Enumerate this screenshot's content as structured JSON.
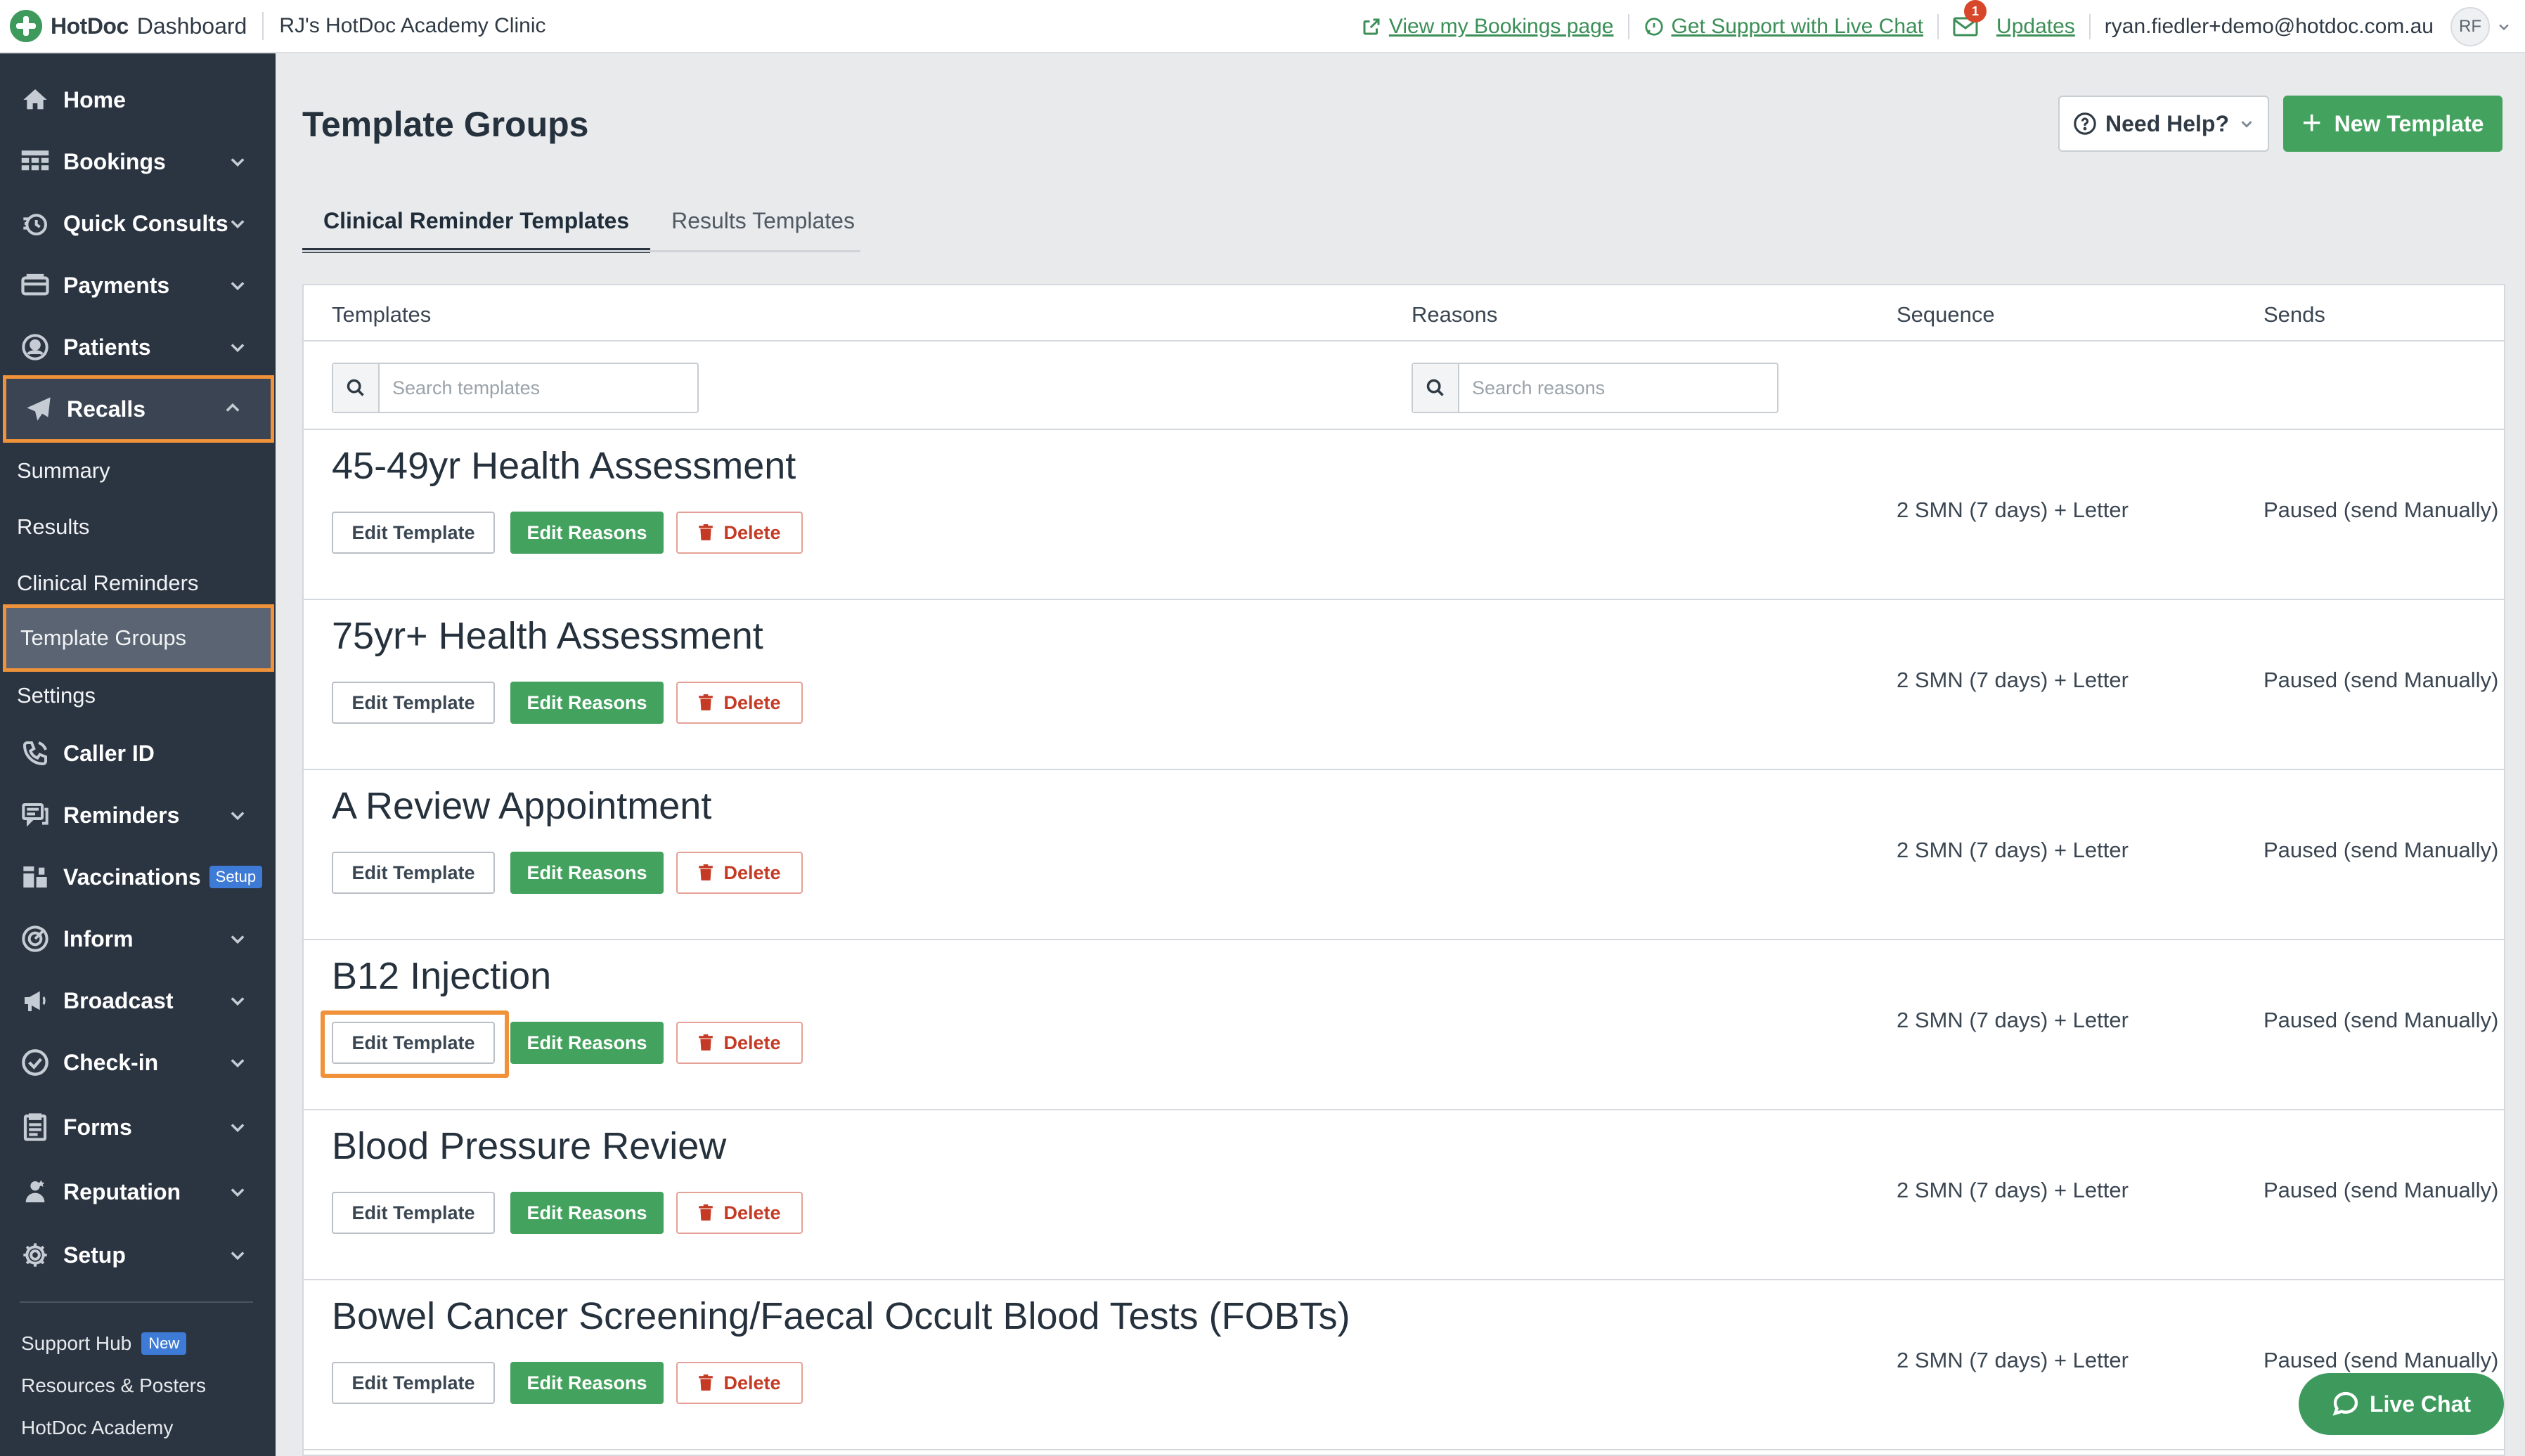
{
  "topbar": {
    "brand_name": "HotDoc",
    "brand_sub": "Dashboard",
    "clinic": "RJ's HotDoc Academy Clinic",
    "view_bookings": "View my Bookings page",
    "support_chat": "Get Support with Live Chat",
    "updates": "Updates",
    "updates_count": "1",
    "user_email": "ryan.fiedler+demo@hotdoc.com.au",
    "avatar_initials": "RF"
  },
  "sidebar": {
    "items": [
      {
        "label": "Home",
        "icon": "home-icon"
      },
      {
        "label": "Bookings",
        "icon": "bookings-icon"
      },
      {
        "label": "Quick Consults",
        "icon": "quick-consults-icon"
      },
      {
        "label": "Payments",
        "icon": "payments-icon"
      },
      {
        "label": "Patients",
        "icon": "patients-icon"
      },
      {
        "label": "Recalls",
        "icon": "recalls-icon"
      },
      {
        "label": "Caller ID",
        "icon": "phone-icon"
      },
      {
        "label": "Reminders",
        "icon": "reminders-icon"
      },
      {
        "label": "Vaccinations",
        "icon": "vaccinations-icon",
        "badge": "Setup"
      },
      {
        "label": "Inform",
        "icon": "inform-icon"
      },
      {
        "label": "Broadcast",
        "icon": "broadcast-icon"
      },
      {
        "label": "Check-in",
        "icon": "check-in-icon"
      },
      {
        "label": "Forms",
        "icon": "forms-icon"
      },
      {
        "label": "Reputation",
        "icon": "reputation-icon"
      },
      {
        "label": "Setup",
        "icon": "gear-icon"
      }
    ],
    "recalls_sub": [
      "Summary",
      "Results",
      "Clinical Reminders",
      "Template Groups",
      "Settings"
    ],
    "footer": {
      "support_hub": "Support Hub",
      "support_badge": "New",
      "resources": "Resources & Posters",
      "academy": "HotDoc Academy"
    },
    "accent": "#f0923a"
  },
  "main": {
    "title": "Template Groups",
    "need_help": "Need Help?",
    "new_template": "New Template",
    "tabs": [
      "Clinical Reminder Templates",
      "Results Templates"
    ],
    "headers": {
      "templates": "Templates",
      "reasons": "Reasons",
      "sequence": "Sequence",
      "sends": "Sends"
    },
    "search_templates_placeholder": "Search templates",
    "search_reasons_placeholder": "Search reasons",
    "buttons": {
      "edit_template": "Edit Template",
      "edit_reasons": "Edit Reasons",
      "delete": "Delete"
    },
    "rows": [
      {
        "name": "45-49yr Health Assessment",
        "sequence": "2 SMN (7 days) + Letter",
        "sends": "Paused (send Manually)"
      },
      {
        "name": "75yr+ Health Assessment",
        "sequence": "2 SMN (7 days) + Letter",
        "sends": "Paused (send Manually)"
      },
      {
        "name": "A Review Appointment",
        "sequence": "2 SMN (7 days) + Letter",
        "sends": "Paused (send Manually)"
      },
      {
        "name": "B12 Injection",
        "sequence": "2 SMN (7 days) + Letter",
        "sends": "Paused (send Manually)"
      },
      {
        "name": "Blood Pressure Review",
        "sequence": "2 SMN (7 days) + Letter",
        "sends": "Paused (send Manually)"
      },
      {
        "name": "Bowel Cancer Screening/Faecal Occult Blood Tests (FOBTs)",
        "sequence": "2 SMN (7 days) + Letter",
        "sends": "Paused (send Manually)"
      }
    ],
    "live_chat": "Live Chat",
    "brand_green": "#44a25f"
  }
}
